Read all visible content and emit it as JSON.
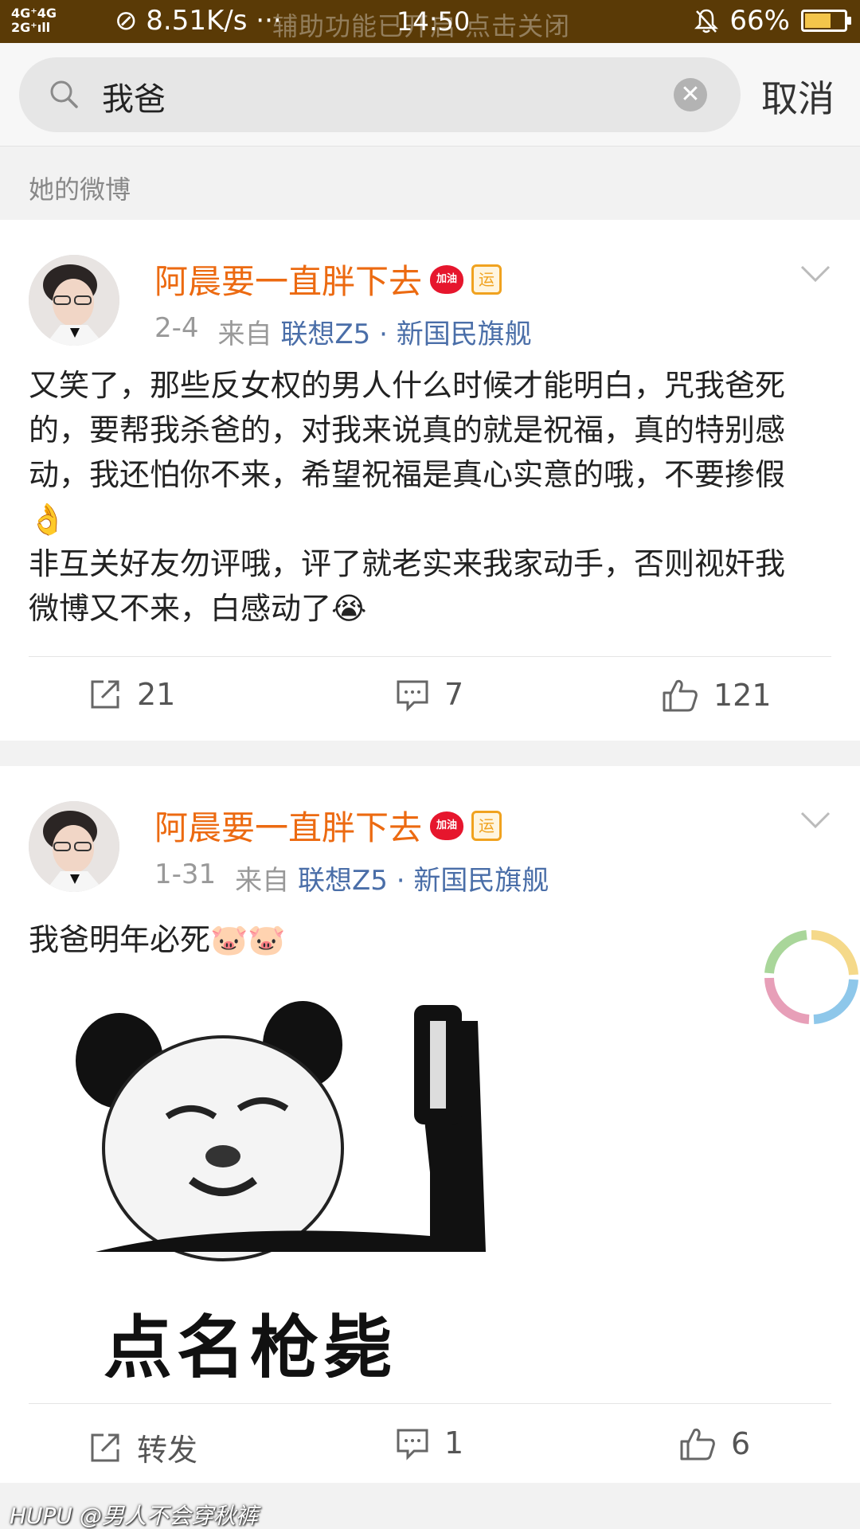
{
  "status_bar": {
    "signal": "4G⁺ 4G\n2G ⁺ıll",
    "speed": "⊘ 8.51K/s ···",
    "accessibility_notice": "辅助功能已开启 点击关闭",
    "time": "14:50",
    "battery": "66%",
    "battery_level": 0.66
  },
  "search": {
    "query": "我爸",
    "cancel_label": "取消"
  },
  "section_label": "她的微博",
  "posts": [
    {
      "username": "阿晨要一直胖下去",
      "heart_badge": "加油",
      "yun_badge": "运",
      "date": "2-4",
      "from": "来自",
      "source": "联想Z5 · 新国民旗舰",
      "text_lines": [
        "又笑了，那些反女权的男人什么时候才能明白，咒我爸死",
        "的，要帮我杀爸的，对我来说真的就是祝福，真的特别感",
        "动，我还怕你不来，希望祝福是真心实意的哦，不要掺假",
        "👌",
        "非互关好友勿评哦，评了就老实来我家动手，否则视奸我",
        "微博又不来，白感动了😭"
      ],
      "repost_count": "21",
      "comment_count": "7",
      "like_count": "121"
    },
    {
      "username": "阿晨要一直胖下去",
      "heart_badge": "加油",
      "yun_badge": "运",
      "date": "1-31",
      "from": "来自",
      "source": "联想Z5 · 新国民旗舰",
      "text": "我爸明年必死🐷🐷",
      "meme_caption": "点名枪毙",
      "repost_label": "转发",
      "comment_count": "1",
      "like_count": "6"
    }
  ],
  "watermark": "HUPU @男人不会穿秋裤",
  "colors": {
    "status_bar_bg": "#5a3a06",
    "username": "#ec6a11",
    "source_link": "#4a6ea8"
  }
}
